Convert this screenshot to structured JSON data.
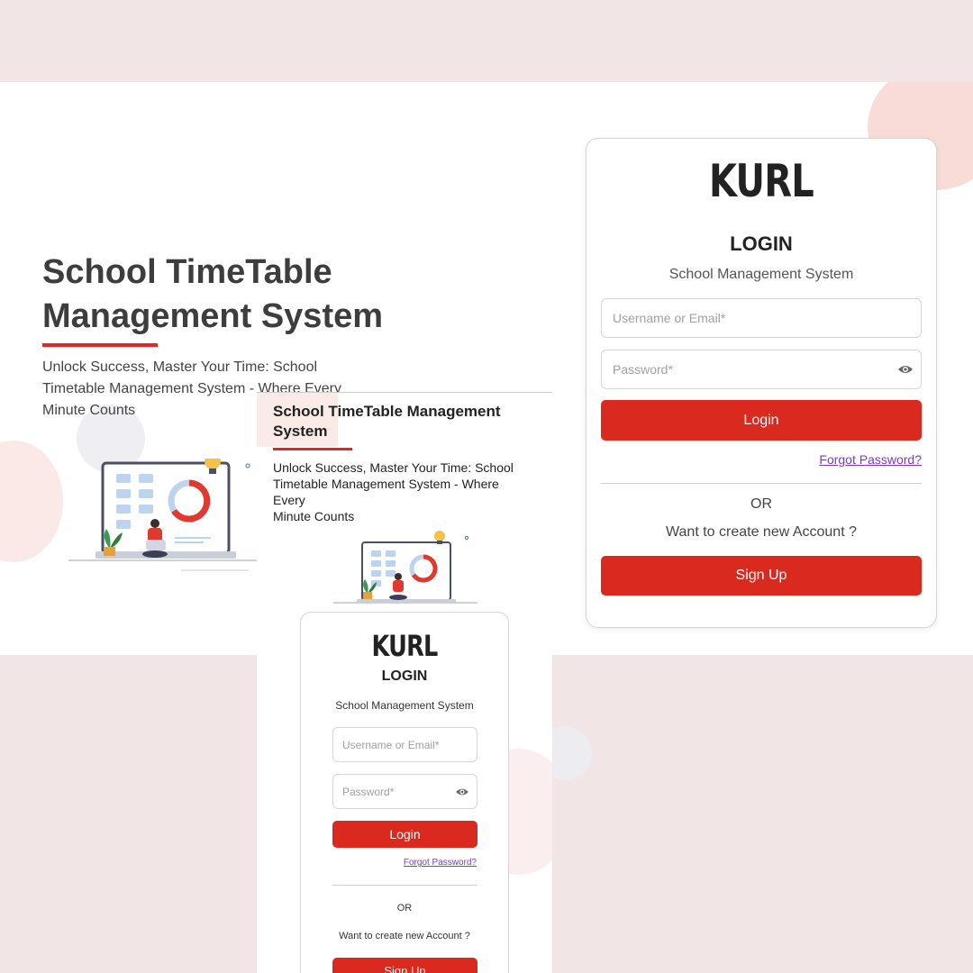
{
  "colors": {
    "accent": "#da2a1f",
    "page_bg": "#f1e5e5",
    "link": "#7a3bbf"
  },
  "hero": {
    "title": "School TimeTable Management System",
    "subtitle": "Unlock Success, Master Your Time: School Timetable Management System - Where Every Minute Counts"
  },
  "login": {
    "logo": "KURL",
    "title": "LOGIN",
    "subtitle": "School Management System",
    "username_placeholder": "Username or Email*",
    "password_placeholder": "Password*",
    "show_password_icon": "eye-icon",
    "login_label": "Login",
    "forgot_label": "Forgot Password?",
    "or_label": "OR",
    "create_prompt": "Want to create new Account ?",
    "signup_label": "Sign Up"
  },
  "mobile": {
    "title": "School TimeTable Management System",
    "subtitle_lines": [
      "Unlock Success, Master Your Time: School",
      "Timetable Management System - Where",
      "Every",
      "Minute Counts"
    ]
  },
  "illustration": {
    "icon": "laptop-user-illustration"
  }
}
